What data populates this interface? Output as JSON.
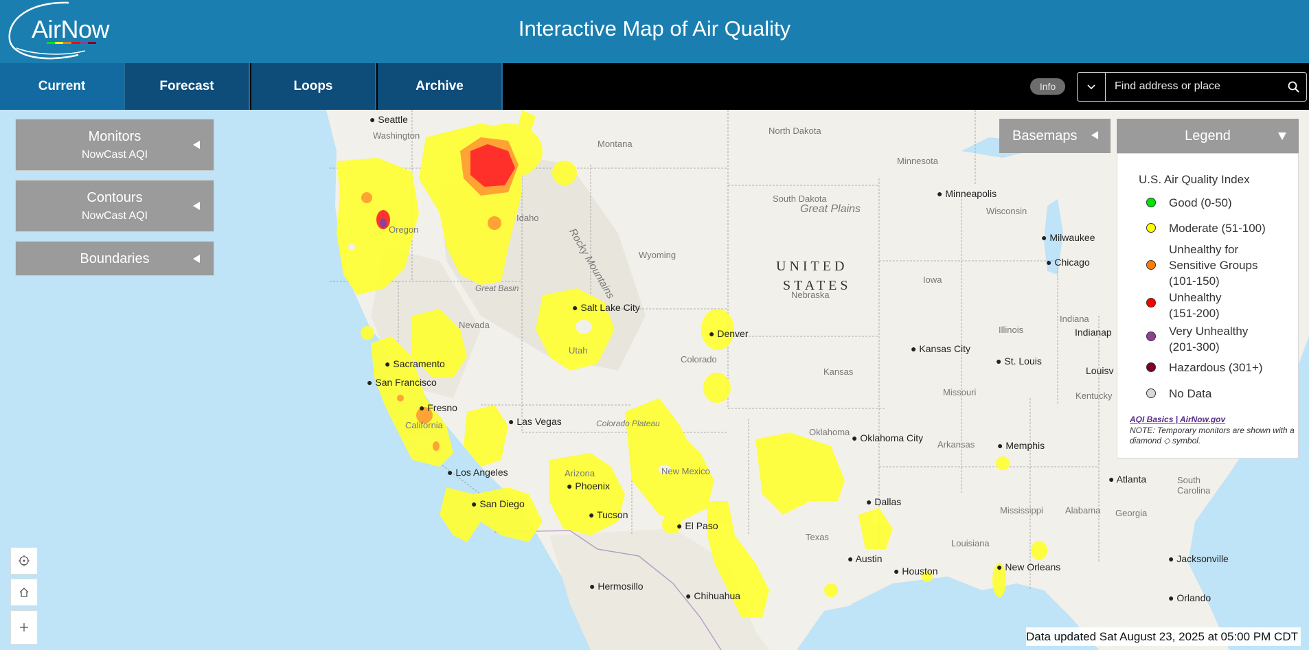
{
  "header": {
    "logo_text": "AirNow",
    "title": "Interactive Map of Air Quality"
  },
  "nav": {
    "tabs": [
      {
        "label": "Current"
      },
      {
        "label": "Forecast"
      },
      {
        "label": "Loops"
      },
      {
        "label": "Archive"
      }
    ]
  },
  "info_label": "Info",
  "search": {
    "placeholder": "Find address or place"
  },
  "panels": {
    "monitors": {
      "title": "Monitors",
      "subtitle": "NowCast AQI"
    },
    "contours": {
      "title": "Contours",
      "subtitle": "NowCast AQI"
    },
    "boundaries": {
      "title": "Boundaries"
    }
  },
  "basemaps_label": "Basemaps",
  "legend": {
    "header": "Legend",
    "title": "U.S. Air Quality Index",
    "items": [
      {
        "label": "Good (0-50)",
        "color": "#00e400"
      },
      {
        "label": "Moderate (51-100)",
        "color": "#ffff00"
      },
      {
        "label": "Unhealthy for Sensitive Groups (101-150)",
        "color": "#ff7e00"
      },
      {
        "label": "Unhealthy (151-200)",
        "color": "#ff0000"
      },
      {
        "label": "Very Unhealthy (201-300)",
        "color": "#8f3f97"
      },
      {
        "label": "Hazardous (301+)",
        "color": "#7e0023"
      },
      {
        "label": "No Data",
        "color": "#d9d9d9"
      }
    ],
    "link": "AQI Basics | AirNow.gov",
    "note": "NOTE: Temporary monitors are shown with a diamond ◇ symbol."
  },
  "updated": "Data updated Sat August 23, 2025 at 05:00 PM CDT",
  "map": {
    "country": [
      "UNITED",
      "STATES"
    ],
    "cities": [
      "Seattle",
      "Minneapolis",
      "Milwaukee",
      "Chicago",
      "Salt Lake City",
      "Denver",
      "Sacramento",
      "San Francisco",
      "Fresno",
      "Las Vegas",
      "Kansas City",
      "St. Louis",
      "Indianap",
      "Louisv",
      "Oklahoma City",
      "Memphis",
      "Atlanta",
      "Los Angeles",
      "San Diego",
      "Phoenix",
      "Tucson",
      "El Paso",
      "Dallas",
      "Austin",
      "Houston",
      "New Orleans",
      "Jacksonville",
      "Orlando",
      "Hermosillo",
      "Chihuahua"
    ],
    "states": [
      "Washington",
      "Montana",
      "North Dakota",
      "Minnesota",
      "South Dakota",
      "Wisconsin",
      "Oregon",
      "Idaho",
      "Wyoming",
      "Nebraska",
      "Iowa",
      "Illinois",
      "Indiana",
      "Nevada",
      "Utah",
      "Colorado",
      "Kansas",
      "Missouri",
      "Kentucky",
      "California",
      "Arizona",
      "New Mexico",
      "Oklahoma",
      "Arkansas",
      "Texas",
      "Mississippi",
      "Alabama",
      "Georgia",
      "Louisiana",
      "South Carolina"
    ],
    "regions": [
      "Rocky Mountains",
      "Great Plains",
      "Great Basin",
      "Colorado Plateau"
    ]
  },
  "colors": {
    "header": "#1a7fb0",
    "nav_tab": "#0e4c7a",
    "panel": "#9b9b9b",
    "water": "#bfe3f7"
  }
}
